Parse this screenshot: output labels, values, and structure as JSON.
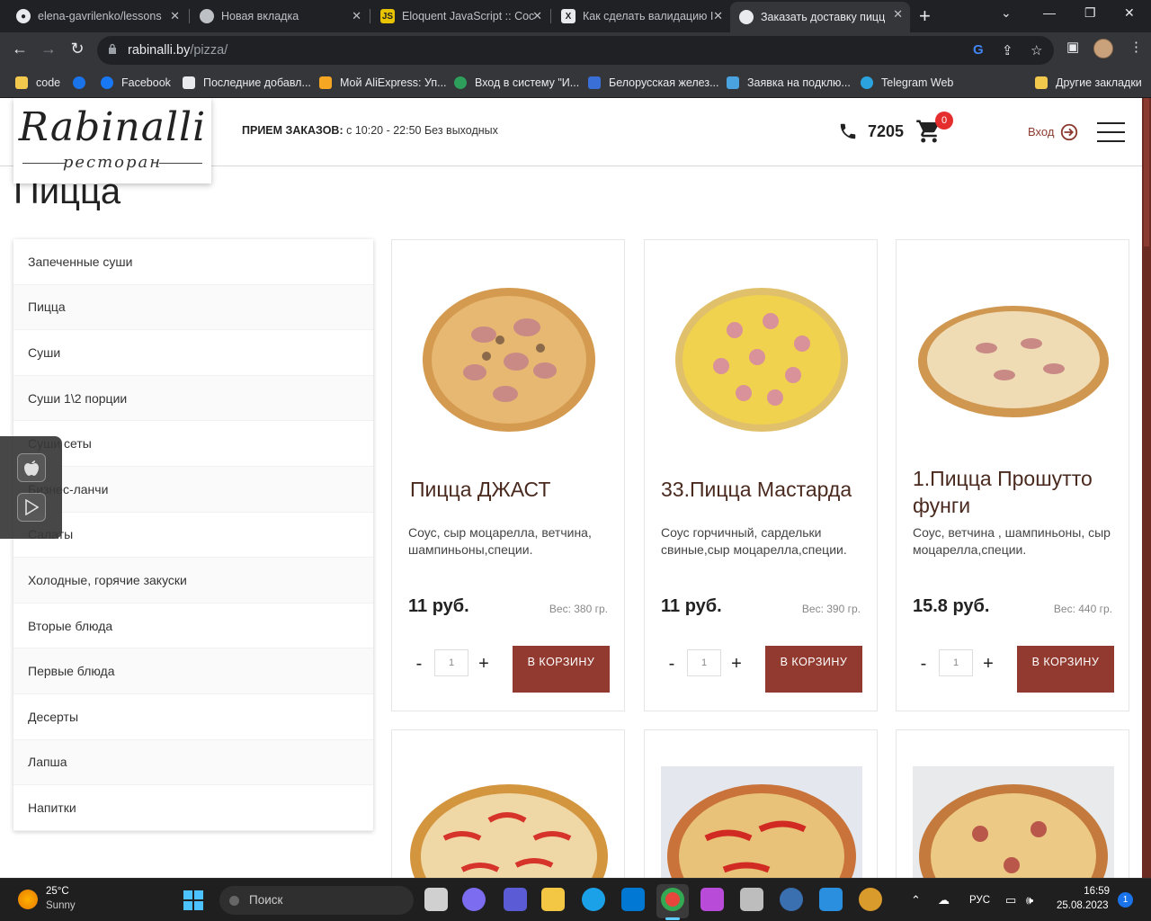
{
  "browser": {
    "tabs": [
      {
        "title": "elena-gavrilenko/lessons",
        "icon": "github-icon",
        "active": false
      },
      {
        "title": "Новая вкладка",
        "icon": "chrome-icon",
        "active": false
      },
      {
        "title": "Eloquent JavaScript :: Coc",
        "icon": "ejs-icon",
        "active": false
      },
      {
        "title": "Как сделать валидацию I",
        "icon": "x-icon",
        "active": false
      },
      {
        "title": "Заказать доставку пицц",
        "icon": "rabinalli-icon",
        "active": true
      }
    ],
    "url_host": "rabinalli.by",
    "url_path": "/pizza/",
    "bookmarks": [
      {
        "label": "code",
        "icon": "folder-icon"
      },
      {
        "label": "",
        "icon": "at-icon"
      },
      {
        "label": "Facebook",
        "icon": "facebook-icon"
      },
      {
        "label": "Последние добавл...",
        "icon": "film-icon"
      },
      {
        "label": "Мой AliExpress: Уп...",
        "icon": "aliexpress-icon"
      },
      {
        "label": "Вход в систему \"И...",
        "icon": "leaf-icon"
      },
      {
        "label": "Белорусская желез...",
        "icon": "railway-icon"
      },
      {
        "label": "Заявка на подклю...",
        "icon": "signal-icon"
      },
      {
        "label": "Telegram Web",
        "icon": "telegram-icon"
      },
      {
        "label": "Другие закладки",
        "icon": "folder-icon"
      }
    ]
  },
  "site": {
    "logo_script": "Rabinalli",
    "logo_sub": "ресторан",
    "hours_label": "ПРИЕМ ЗАКАЗОВ:",
    "hours_value": "с 10:20 - 22:50 Без выходных",
    "phone": "7205",
    "cart_count": "0",
    "login": "Вход",
    "page_title": "Пицца",
    "categories": [
      "Запеченные суши",
      "Пицца",
      "Суши",
      "Суши 1\\2 порции",
      "Суши сеты",
      "Бизнес-ланчи",
      "Салаты",
      "Холодные, горячие закуски",
      "Вторые блюда",
      "Первые блюда",
      "Десерты",
      "Лапша",
      "Напитки"
    ],
    "products": [
      {
        "title": "Пицца ДЖАСТ",
        "desc": "Соус, сыр моцарелла, ветчина, шампиньоны,специи.",
        "price": "11 руб.",
        "weight": "Вес: 380 гр.",
        "qty": "1",
        "button": "В КОРЗИНУ"
      },
      {
        "title": "33.Пицца Мастарда",
        "desc": "Соус горчичный, сардельки свиные,сыр моцарелла,специи.",
        "price": "11 руб.",
        "weight": "Вес: 390 гр.",
        "qty": "1",
        "button": "В КОРЗИНУ"
      },
      {
        "title": "1.Пицца Прошутто фунги",
        "desc": "Соус, ветчина , шампиньоны, сыр моцарелла,специи.",
        "price": "15.8 руб.",
        "weight": "Вес: 440 гр.",
        "qty": "1",
        "button": "В КОРЗИНУ"
      }
    ],
    "colors": {
      "accent": "#923a2f",
      "title_brown": "#4a2a1f",
      "badge": "#e52d2d"
    }
  },
  "taskbar": {
    "temperature": "25°C",
    "condition": "Sunny",
    "search": "Поиск",
    "language": "РУС",
    "time": "16:59",
    "date": "25.08.2023",
    "notifications": "1"
  }
}
